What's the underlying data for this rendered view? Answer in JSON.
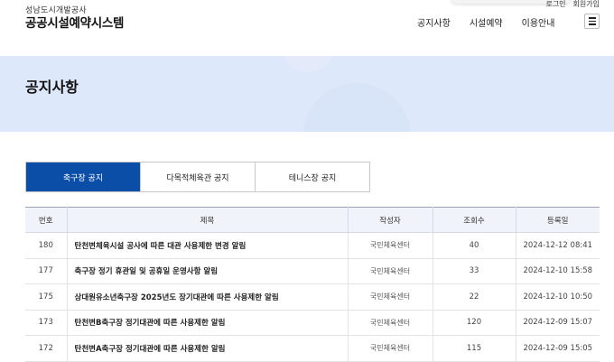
{
  "util": {
    "login": "로그인",
    "signup": "회원가입"
  },
  "logo": {
    "sub": "성남도시개발공사",
    "main": "공공시설예약시스템"
  },
  "nav": [
    "공지사항",
    "시설예약",
    "이용안내"
  ],
  "banner": {
    "title": "공지사항"
  },
  "tabs": [
    {
      "label": "축구장 공지",
      "active": true
    },
    {
      "label": "다목적체육관 공지",
      "active": false
    },
    {
      "label": "테니스장 공지",
      "active": false
    }
  ],
  "table": {
    "headers": [
      "번호",
      "제목",
      "작성자",
      "조회수",
      "등록일"
    ],
    "rows": [
      {
        "no": "180",
        "title": "탄천변체육시설 공사에 따른 대관 사용제한 변경 알림",
        "author": "국민체육센터",
        "views": "40",
        "date": "2024-12-12 08:41"
      },
      {
        "no": "177",
        "title": "축구장 정기 휴관일 및 공휴일 운영사항 알림",
        "author": "국민체육센터",
        "views": "33",
        "date": "2024-12-10 15:58"
      },
      {
        "no": "175",
        "title": "상대원유소년축구장 2025년도 장기대관에 따른 사용제한 알림",
        "author": "국민체육센터",
        "views": "22",
        "date": "2024-12-10 10:50"
      },
      {
        "no": "173",
        "title": "탄천변B축구장 정기대관에 따른 사용제한 알림",
        "author": "국민체육센터",
        "views": "120",
        "date": "2024-12-09 15:07"
      },
      {
        "no": "172",
        "title": "탄천변A축구장 정기대관에 따른 사용제한 알림",
        "author": "국민체육센터",
        "views": "115",
        "date": "2024-12-09 15:05"
      }
    ]
  },
  "colors": {
    "accent": "#0a4ea8",
    "banner": "#dde8fa"
  }
}
